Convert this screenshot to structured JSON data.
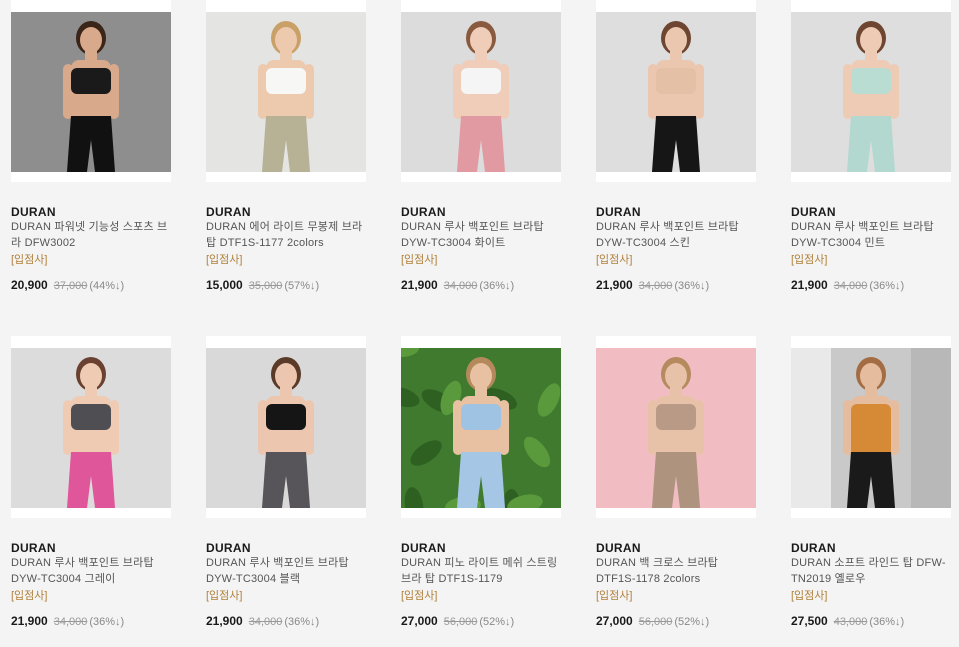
{
  "products": [
    {
      "brand": "DURAN",
      "name": "DURAN 파워넷 기능성 스포츠 브라 DFW3002",
      "badge": "[입점사]",
      "sale_price": "20,900",
      "original_price": "37,000",
      "discount": "(44%↓)",
      "photo": {
        "bg": "#8e8e8e",
        "skin": "#d9a98c",
        "top": "#1a1a1a",
        "bottom": "#111111",
        "hair": "#3b2418"
      }
    },
    {
      "brand": "DURAN",
      "name": "DURAN 에어 라이트 무봉제 브라탑 DTF1S-1177 2colors",
      "badge": "[입점사]",
      "sale_price": "15,000",
      "original_price": "35,000",
      "discount": "(57%↓)",
      "photo": {
        "bg": "#e4e4e2",
        "skin": "#edc9ae",
        "top": "#f7f7f5",
        "bottom": "#b7b196",
        "hair": "#c9a067"
      }
    },
    {
      "brand": "DURAN",
      "name": "DURAN 루사 백포인트 브라탑 DYW-TC3004 화이트",
      "badge": "[입점사]",
      "sale_price": "21,900",
      "original_price": "34,000",
      "discount": "(36%↓)",
      "photo": {
        "bg": "#dcdcdc",
        "skin": "#efcdb8",
        "top": "#f5f5f5",
        "bottom": "#e19aa2",
        "hair": "#8a5a3e"
      }
    },
    {
      "brand": "DURAN",
      "name": "DURAN 루사 백포인트 브라탑 DYW-TC3004 스킨",
      "badge": "[입점사]",
      "sale_price": "21,900",
      "original_price": "34,000",
      "discount": "(36%↓)",
      "photo": {
        "bg": "#dedede",
        "skin": "#ecc7b0",
        "top": "#e3c0a6",
        "bottom": "#161616",
        "hair": "#6e4530"
      }
    },
    {
      "brand": "DURAN",
      "name": "DURAN 루사 백포인트 브라탑 DYW-TC3004 민트",
      "badge": "[입점사]",
      "sale_price": "21,900",
      "original_price": "34,000",
      "discount": "(36%↓)",
      "photo": {
        "bg": "#dedede",
        "skin": "#edcbb5",
        "top": "#b9dcd3",
        "bottom": "#b3d8cf",
        "hair": "#6e4530"
      }
    },
    {
      "brand": "DURAN",
      "name": "DURAN 루사 백포인트 브라탑 DYW-TC3004 그레이",
      "badge": "[입점사]",
      "sale_price": "21,900",
      "original_price": "34,000",
      "discount": "(36%↓)",
      "photo": {
        "bg": "#dcdcdc",
        "skin": "#efcbb4",
        "top": "#4f4f53",
        "bottom": "#e0569a",
        "hair": "#6a4130"
      }
    },
    {
      "brand": "DURAN",
      "name": "DURAN 루사 백포인트 브라탑 DYW-TC3004 블랙",
      "badge": "[입점사]",
      "sale_price": "21,900",
      "original_price": "34,000",
      "discount": "(36%↓)",
      "photo": {
        "bg": "#d9d9d9",
        "skin": "#ecc6ae",
        "top": "#151515",
        "bottom": "#57555a",
        "hair": "#5a3a28"
      }
    },
    {
      "brand": "DURAN",
      "name": "DURAN 피노 라이트 메쉬 스트링 브라 탑 DTF1S-1179",
      "badge": "[입점사]",
      "sale_price": "27,000",
      "original_price": "56,000",
      "discount": "(52%↓)",
      "photo": {
        "bg": "#3f7a2e",
        "skin": "#e8c0a2",
        "top": "#9ec3e3",
        "bottom": "#a6c6e6",
        "hair": "#b48a5c"
      }
    },
    {
      "brand": "DURAN",
      "name": "DURAN 백 크로스 브라탑 DTF1S-1178 2colors",
      "badge": "[입점사]",
      "sale_price": "27,000",
      "original_price": "56,000",
      "discount": "(52%↓)",
      "photo": {
        "bg": "#f1bdc3",
        "skin": "#e8c2a8",
        "top": "#b89a86",
        "bottom": "#ae937f",
        "hair": "#b58a5e"
      }
    },
    {
      "brand": "DURAN",
      "name": "DURAN 소프트 라인드 탑 DFW-TN2019 옐로우",
      "badge": "[입점사]",
      "sale_price": "27,500",
      "original_price": "43,000",
      "discount": "(36%↓)",
      "photo": {
        "bg": "#c9c9c9",
        "skin": "#e6bc9e",
        "top": "#d68a35",
        "bottom": "#1a1a1a",
        "hair": "#a36c43"
      }
    }
  ]
}
